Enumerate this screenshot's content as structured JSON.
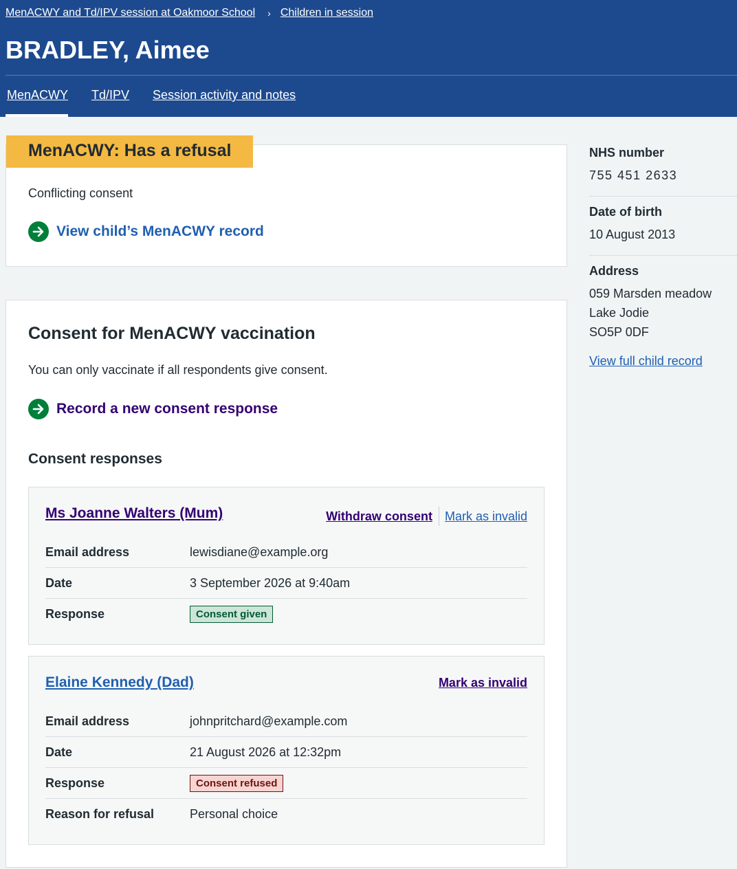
{
  "breadcrumb": {
    "session": "MenACWY and Td/IPV session at Oakmoor School",
    "children": "Children in session"
  },
  "page_title": "BRADLEY, Aimee",
  "tabs": [
    "MenACWY",
    "Td/IPV",
    "Session activity and notes"
  ],
  "status": {
    "tag": "MenACWY: Has a refusal",
    "detail": "Conflicting consent",
    "link": "View child’s MenACWY record"
  },
  "consent": {
    "heading": "Consent for MenACWY vaccination",
    "intro": "You can only vaccinate if all respondents give consent.",
    "record_link": "Record a new consent response",
    "responses_heading": "Consent responses",
    "responses": [
      {
        "name": "Ms Joanne Walters (Mum)",
        "withdraw": "Withdraw consent",
        "invalid": "Mark as invalid",
        "email_label": "Email address",
        "email": "lewisdiane@example.org",
        "date_label": "Date",
        "date": "3 September 2026 at 9:40am",
        "response_label": "Response",
        "response": "Consent given"
      },
      {
        "name": "Elaine Kennedy (Dad)",
        "invalid": "Mark as invalid",
        "email_label": "Email address",
        "email": "johnpritchard@example.com",
        "date_label": "Date",
        "date": "21 August 2026 at 12:32pm",
        "response_label": "Response",
        "response": "Consent refused",
        "reason_label": "Reason for refusal",
        "reason": "Personal choice"
      }
    ]
  },
  "sidebar": {
    "nhs_label": "NHS number",
    "nhs_value": "755 451 2633",
    "dob_label": "Date of birth",
    "dob_value": "10 August 2013",
    "address_label": "Address",
    "address_lines": [
      "059 Marsden meadow",
      "Lake Jodie",
      "SO5P 0DF"
    ],
    "full_record_link": "View full child record"
  },
  "colors": {
    "header": "#1d4a8f",
    "status_tag": "#f4b942",
    "arrow_green": "#007f3b",
    "link_blue": "#1f5fb0",
    "link_purple": "#330072"
  }
}
